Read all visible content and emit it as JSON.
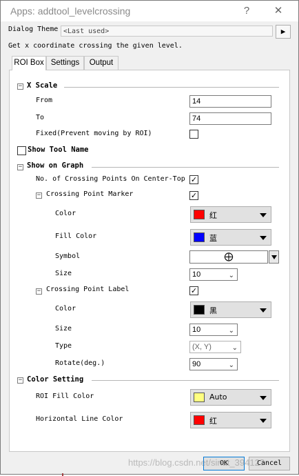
{
  "window": {
    "title": "Apps: addtool_levelcrossing",
    "help_label": "?",
    "close_label": "✕"
  },
  "theme": {
    "label": "Dialog Theme",
    "value": "<Last used>",
    "button_label": "▶"
  },
  "description": "Get x coordinate crossing the given level.",
  "tabs": [
    {
      "label": "ROI Box",
      "active": true
    },
    {
      "label": "Settings",
      "active": false
    },
    {
      "label": "Output",
      "active": false
    }
  ],
  "x_scale": {
    "title": "X Scale",
    "from_label": "From",
    "from_value": "14",
    "to_label": "To",
    "to_value": "74",
    "fixed_label": "Fixed(Prevent moving by ROI)",
    "fixed_checked": false
  },
  "show_tool_name": {
    "label": "Show Tool Name",
    "checked": false
  },
  "show_on_graph": {
    "title": "Show on Graph",
    "count_label": "No. of Crossing Points On Center-Top",
    "count_checked": true,
    "marker": {
      "title": "Crossing Point Marker",
      "checked": true,
      "color_label": "Color",
      "color_name": "红",
      "color_hex": "#ff0000",
      "fill_label": "Fill Color",
      "fill_name": "蓝",
      "fill_hex": "#0000ff",
      "symbol_label": "Symbol",
      "symbol_glyph": "⨁",
      "size_label": "Size",
      "size_value": "10"
    },
    "label_group": {
      "title": "Crossing Point Label",
      "checked": true,
      "color_label": "Color",
      "color_name": "黑",
      "color_hex": "#000000",
      "size_label": "Size",
      "size_value": "10",
      "type_label": "Type",
      "type_value": "(X, Y)",
      "rotate_label": "Rotate(deg.)",
      "rotate_value": "90"
    }
  },
  "color_setting": {
    "title": "Color Setting",
    "roi_label": "ROI Fill Color",
    "roi_name": "Auto",
    "roi_hex": "#ffff80",
    "hline_label": "Horizontal Line Color",
    "hline_name": "红",
    "hline_hex": "#ff0000"
  },
  "buttons": {
    "ok": "OK",
    "cancel": "Cancel"
  },
  "watermark": "https://blog.csdn.net/sinat_39412?"
}
